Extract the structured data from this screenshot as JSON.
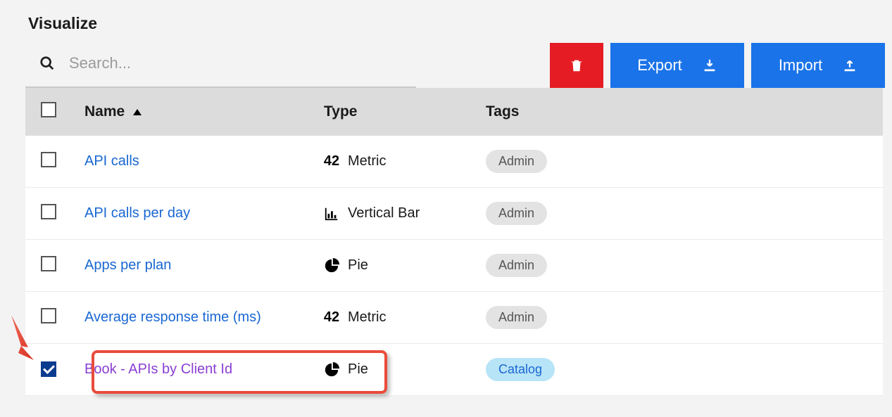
{
  "title": "Visualize",
  "search": {
    "placeholder": "Search..."
  },
  "buttons": {
    "delete_aria": "Delete",
    "export_label": "Export",
    "import_label": "Import"
  },
  "columns": {
    "name": "Name",
    "type": "Type",
    "tags": "Tags"
  },
  "type_icon_labels": {
    "metric": "42",
    "vertical_bar": "vertical-bar",
    "pie": "pie"
  },
  "rows": [
    {
      "checked": false,
      "name": "API calls",
      "visited": false,
      "type_icon": "metric",
      "type_label": "Metric",
      "tag": "Admin",
      "tag_style": "admin"
    },
    {
      "checked": false,
      "name": "API calls per day",
      "visited": false,
      "type_icon": "vertical_bar",
      "type_label": "Vertical Bar",
      "tag": "Admin",
      "tag_style": "admin"
    },
    {
      "checked": false,
      "name": "Apps per plan",
      "visited": false,
      "type_icon": "pie",
      "type_label": "Pie",
      "tag": "Admin",
      "tag_style": "admin"
    },
    {
      "checked": false,
      "name": "Average response time (ms)",
      "visited": false,
      "type_icon": "metric",
      "type_label": "Metric",
      "tag": "Admin",
      "tag_style": "admin"
    },
    {
      "checked": true,
      "name": "Book - APIs by Client Id",
      "visited": true,
      "type_icon": "pie",
      "type_label": "Pie",
      "tag": "Catalog",
      "tag_style": "catalog"
    }
  ],
  "callout": {
    "row_index": 4
  }
}
